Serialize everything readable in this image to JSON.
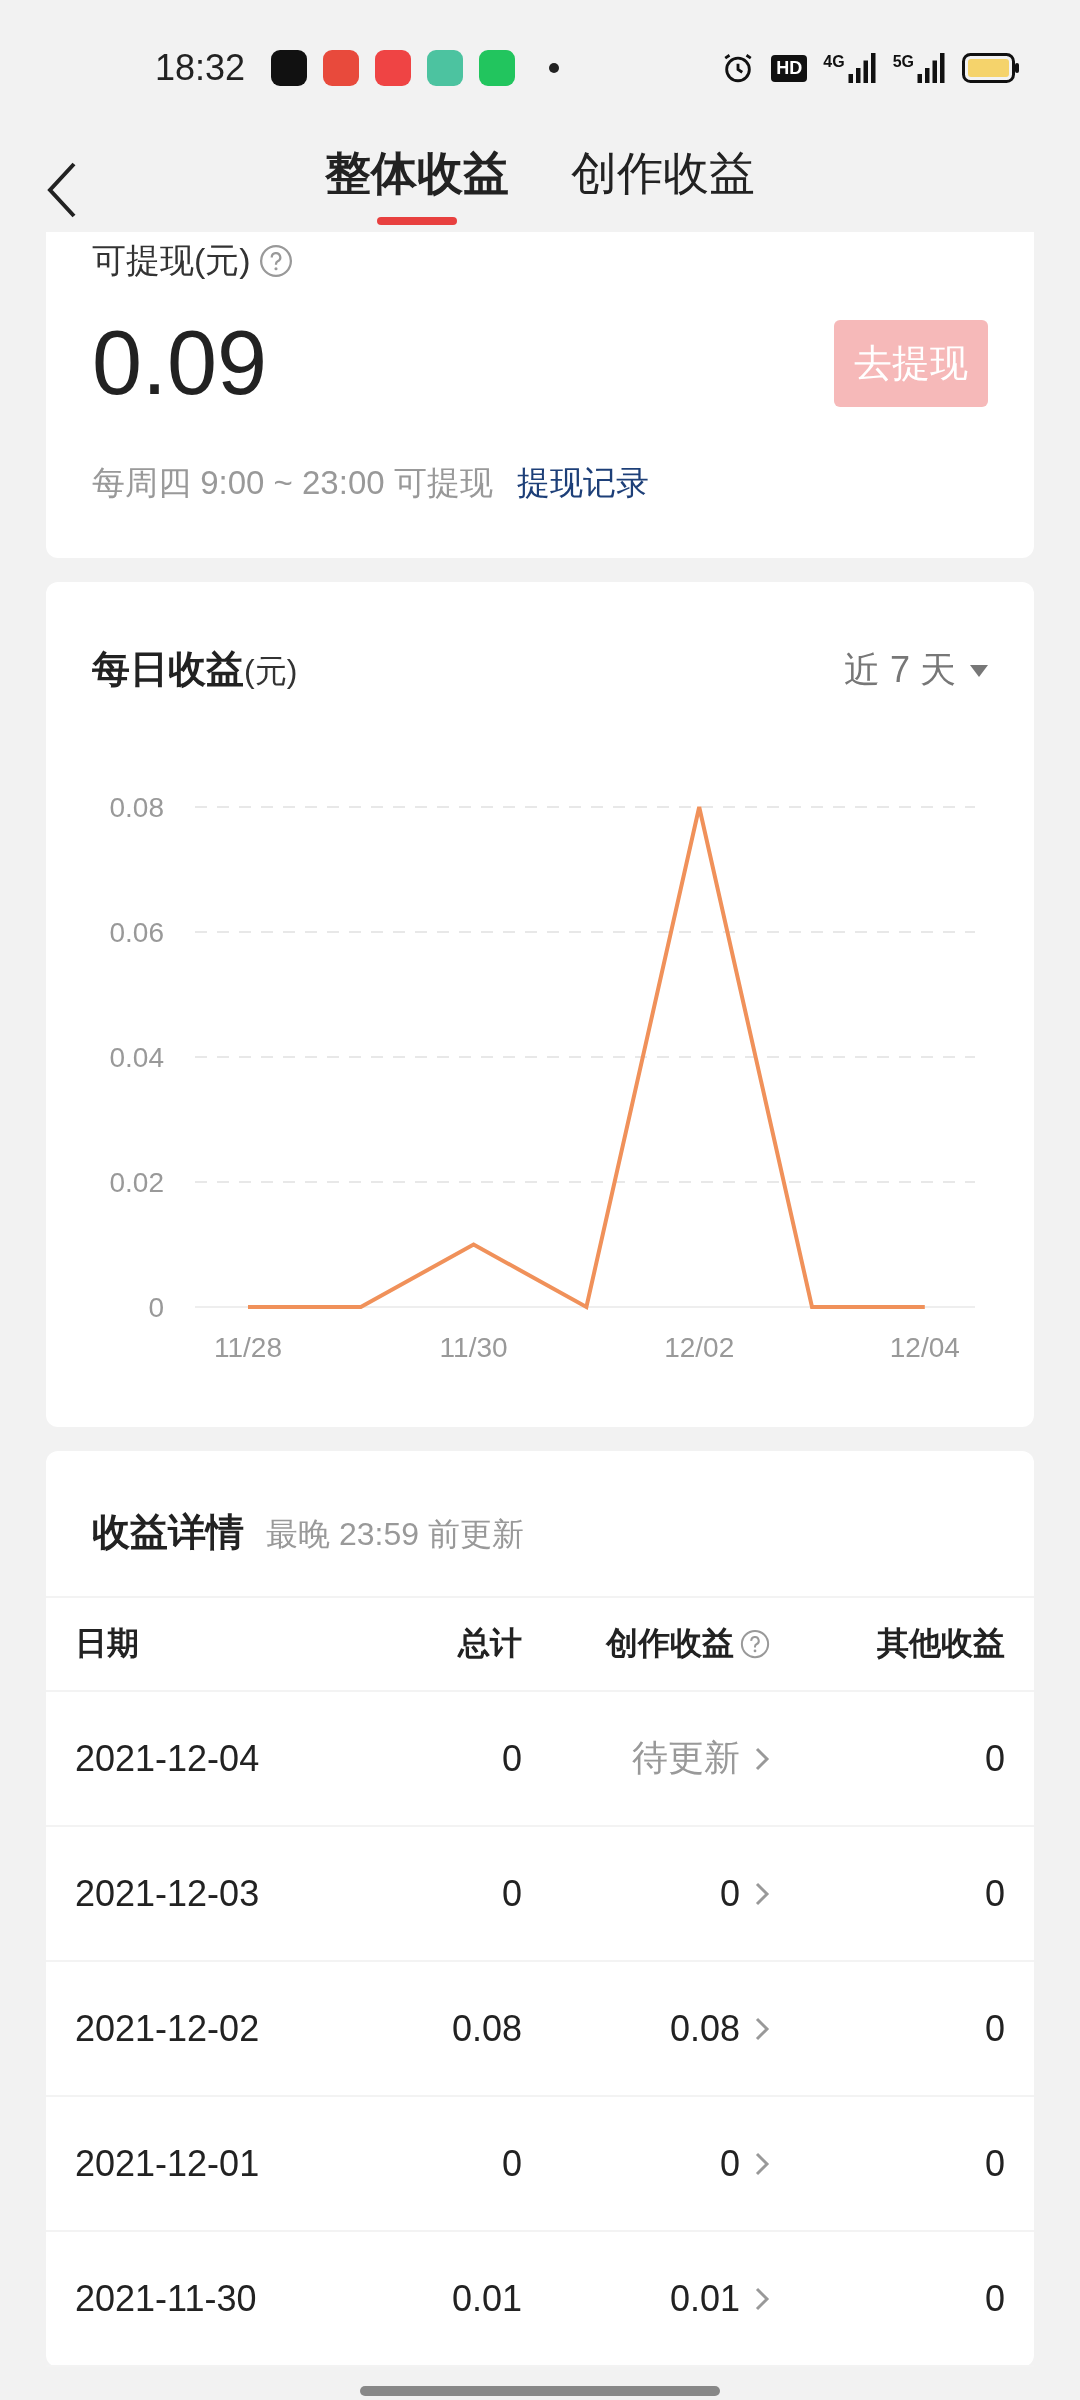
{
  "status_bar": {
    "time": "18:32",
    "notifications": [
      {
        "color": "#111111"
      },
      {
        "color": "#e84a3c"
      },
      {
        "color": "#ef4444"
      },
      {
        "color": "#4cc3a0"
      },
      {
        "color": "#22c55e"
      }
    ],
    "network_labels": [
      "4G",
      "5G"
    ],
    "hd_label": "HD"
  },
  "nav": {
    "tabs": [
      {
        "label": "整体收益",
        "selected": true
      },
      {
        "label": "创作收益",
        "selected": false
      }
    ]
  },
  "balance": {
    "label": "可提现(元)",
    "amount": "0.09",
    "button": "去提现",
    "button_disabled": true,
    "note": "每周四 9:00 ~ 23:00 可提现",
    "link": "提现记录"
  },
  "daily": {
    "title": "每日收益",
    "unit": "(元)",
    "range": "近 7 天",
    "chart_data": {
      "type": "line",
      "categories": [
        "11/28",
        null,
        "11/30",
        null,
        "12/02",
        null,
        "12/04"
      ],
      "series": [
        {
          "color": "#f0915a",
          "values": [
            0,
            0,
            0.01,
            0,
            0.08,
            0,
            0
          ]
        }
      ],
      "yticks": [
        0,
        {
          "value": 0.02,
          "label": "0.02"
        },
        {
          "value": 0.04,
          "label": "0.04"
        },
        {
          "value": 0.06,
          "label": "0.06"
        },
        {
          "value": 0.08,
          "label": "0.08"
        }
      ],
      "ylim": [
        0,
        0.08
      ],
      "grid": true
    }
  },
  "details": {
    "title": "收益详情",
    "subtitle": "最晚 23:59 前更新",
    "columns": [
      "日期",
      "总计",
      "创作收益",
      "其他收益"
    ],
    "rows": [
      {
        "date": "2021-12-04",
        "total": "0",
        "creative": "待更新",
        "pending": true,
        "other": "0"
      },
      {
        "date": "2021-12-03",
        "total": "0",
        "creative": "0",
        "pending": false,
        "other": "0"
      },
      {
        "date": "2021-12-02",
        "total": "0.08",
        "creative": "0.08",
        "pending": false,
        "other": "0"
      },
      {
        "date": "2021-12-01",
        "total": "0",
        "creative": "0",
        "pending": false,
        "other": "0"
      },
      {
        "date": "2021-11-30",
        "total": "0.01",
        "creative": "0.01",
        "pending": false,
        "other": "0"
      }
    ]
  }
}
